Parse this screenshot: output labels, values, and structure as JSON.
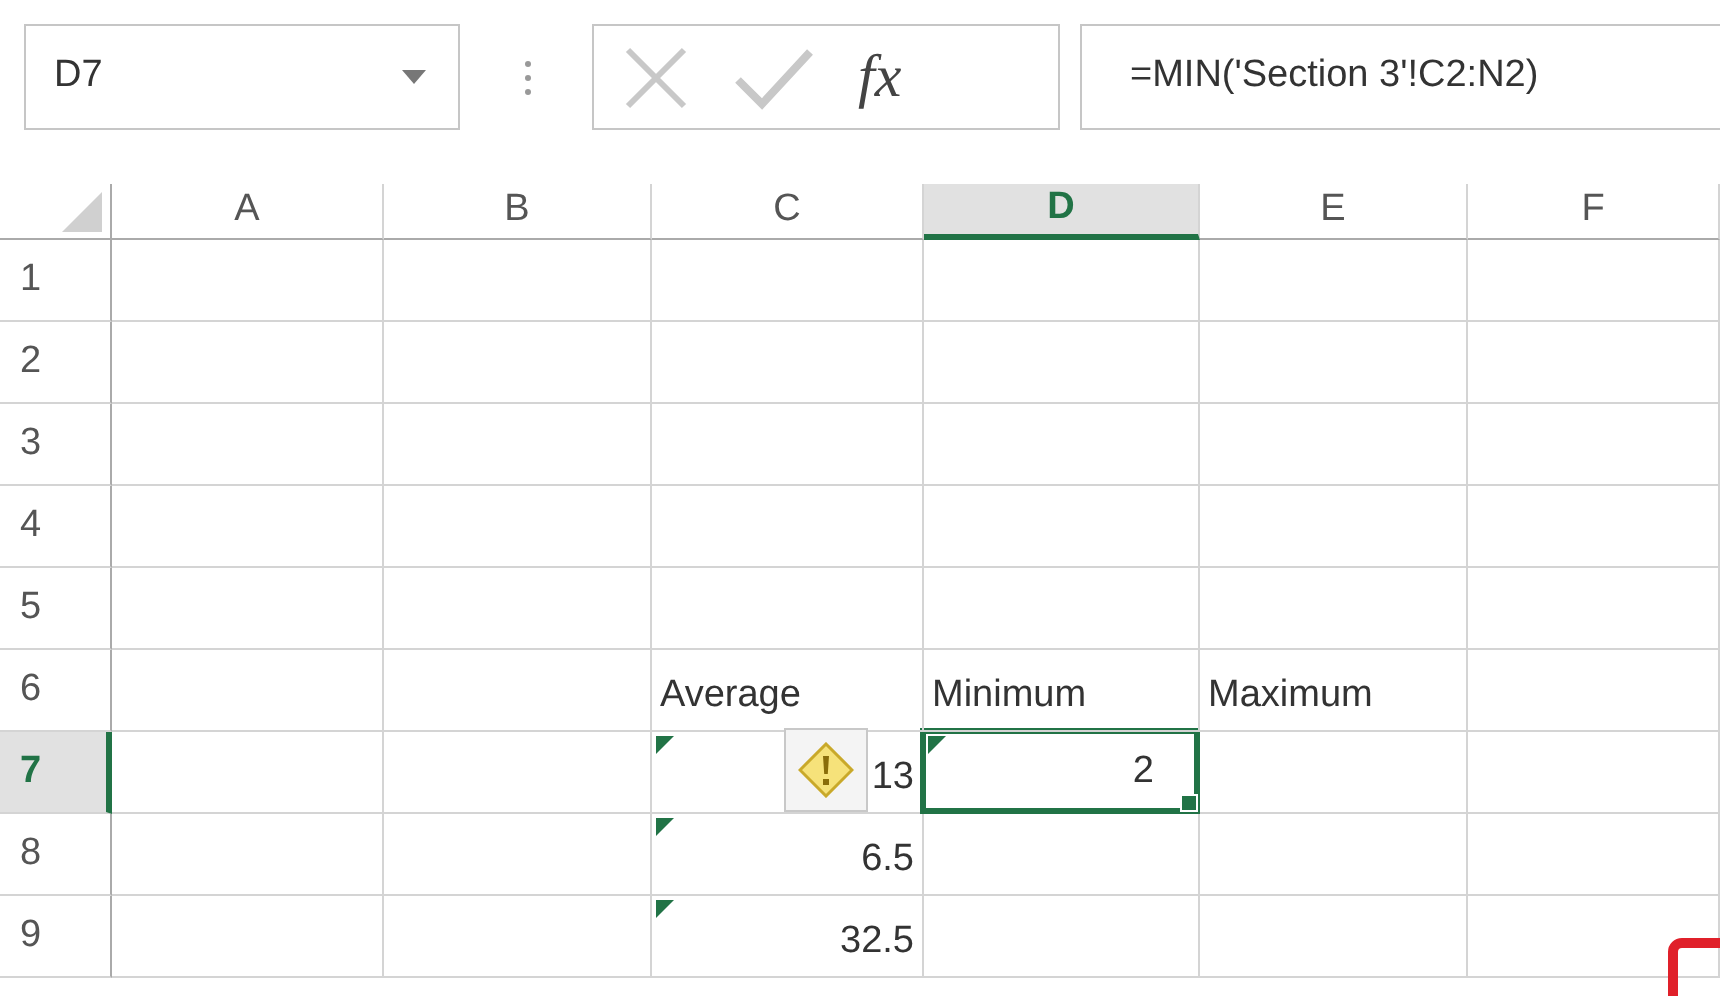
{
  "name_box": {
    "value": "D7"
  },
  "formula_bar": {
    "function_label": "fx",
    "formula": "=MIN('Section 3'!C2:N2)"
  },
  "columns": [
    {
      "label": "A",
      "selected": false
    },
    {
      "label": "B",
      "selected": false
    },
    {
      "label": "C",
      "selected": false
    },
    {
      "label": "D",
      "selected": true
    },
    {
      "label": "E",
      "selected": false
    },
    {
      "label": "F",
      "selected": false
    }
  ],
  "rows": [
    {
      "header": "1",
      "selected": false,
      "cells": [
        {
          "kind": "empty",
          "selected": false
        },
        {
          "kind": "empty",
          "selected": false
        },
        {
          "kind": "empty",
          "selected": false
        },
        {
          "kind": "empty",
          "selected": false
        },
        {
          "kind": "empty",
          "selected": false
        },
        {
          "kind": "empty",
          "selected": false
        }
      ]
    },
    {
      "header": "2",
      "selected": false,
      "cells": [
        {
          "kind": "empty",
          "selected": false
        },
        {
          "kind": "empty",
          "selected": false
        },
        {
          "kind": "empty",
          "selected": false
        },
        {
          "kind": "empty",
          "selected": false
        },
        {
          "kind": "empty",
          "selected": false
        },
        {
          "kind": "empty",
          "selected": false
        }
      ]
    },
    {
      "header": "3",
      "selected": false,
      "cells": [
        {
          "kind": "empty",
          "selected": false
        },
        {
          "kind": "empty",
          "selected": false
        },
        {
          "kind": "empty",
          "selected": false
        },
        {
          "kind": "empty",
          "selected": false
        },
        {
          "kind": "empty",
          "selected": false
        },
        {
          "kind": "empty",
          "selected": false
        }
      ]
    },
    {
      "header": "4",
      "selected": false,
      "cells": [
        {
          "kind": "empty",
          "selected": false
        },
        {
          "kind": "empty",
          "selected": false
        },
        {
          "kind": "empty",
          "selected": false
        },
        {
          "kind": "empty",
          "selected": false
        },
        {
          "kind": "empty",
          "selected": false
        },
        {
          "kind": "empty",
          "selected": false
        }
      ]
    },
    {
      "header": "5",
      "selected": false,
      "cells": [
        {
          "kind": "empty",
          "selected": false
        },
        {
          "kind": "empty",
          "selected": false
        },
        {
          "kind": "empty",
          "selected": false
        },
        {
          "kind": "empty",
          "selected": false
        },
        {
          "kind": "empty",
          "selected": false
        },
        {
          "kind": "empty",
          "selected": false
        }
      ]
    },
    {
      "header": "6",
      "selected": false,
      "cells": [
        {
          "kind": "empty",
          "selected": false
        },
        {
          "kind": "empty",
          "selected": false
        },
        {
          "kind": "text",
          "text": "Average",
          "selected": false,
          "error_flag": false,
          "warning": false
        },
        {
          "kind": "text",
          "text": "Minimum",
          "selected": false,
          "error_flag": false,
          "warning": false
        },
        {
          "kind": "text",
          "text": "Maximum",
          "selected": false,
          "error_flag": false,
          "warning": false
        },
        {
          "kind": "empty",
          "selected": false
        }
      ]
    },
    {
      "header": "7",
      "selected": true,
      "cells": [
        {
          "kind": "empty",
          "selected": false
        },
        {
          "kind": "empty",
          "selected": false
        },
        {
          "kind": "number",
          "text": "13",
          "selected": false,
          "error_flag": true,
          "warning": true
        },
        {
          "kind": "number",
          "text": "2",
          "selected": true,
          "error_flag": true,
          "warning": false,
          "fill_handle_highlighted": true
        },
        {
          "kind": "empty",
          "selected": false
        },
        {
          "kind": "empty",
          "selected": false
        }
      ]
    },
    {
      "header": "8",
      "selected": false,
      "cells": [
        {
          "kind": "empty",
          "selected": false
        },
        {
          "kind": "empty",
          "selected": false
        },
        {
          "kind": "number",
          "text": "6.5",
          "selected": false,
          "error_flag": true,
          "warning": false
        },
        {
          "kind": "empty",
          "selected": false
        },
        {
          "kind": "empty",
          "selected": false
        },
        {
          "kind": "empty",
          "selected": false
        }
      ]
    },
    {
      "header": "9",
      "selected": false,
      "cells": [
        {
          "kind": "empty",
          "selected": false
        },
        {
          "kind": "empty",
          "selected": false
        },
        {
          "kind": "number",
          "text": "32.5",
          "selected": false,
          "error_flag": true,
          "warning": false
        },
        {
          "kind": "empty",
          "selected": false
        },
        {
          "kind": "empty",
          "selected": false
        },
        {
          "kind": "empty",
          "selected": false
        }
      ]
    }
  ]
}
